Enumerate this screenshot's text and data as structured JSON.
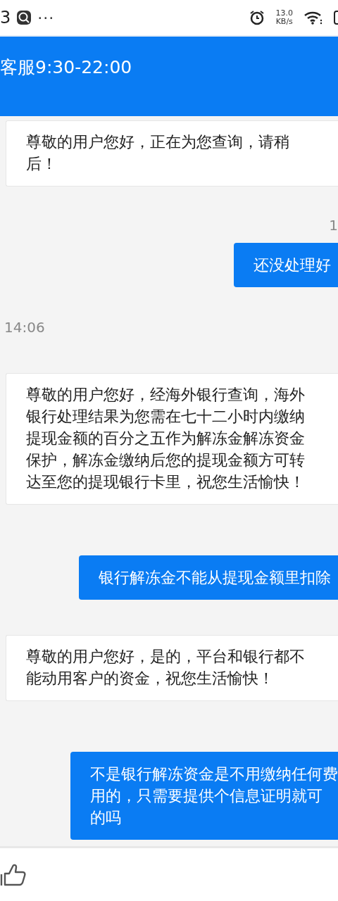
{
  "status_bar": {
    "time": "3",
    "more": "···",
    "speed_value": "13.0",
    "speed_unit": "KB/s"
  },
  "header": {
    "title": "客服9:30-22:00"
  },
  "messages": [
    {
      "kind": "agent",
      "lines": [
        "尊敬的用户您好，正在为您查询，请稍",
        "后！"
      ]
    },
    {
      "kind": "time",
      "text": "1",
      "right_aligned": true
    },
    {
      "kind": "user",
      "lines": [
        "还没处理好"
      ]
    },
    {
      "kind": "time",
      "text": "14:06",
      "right_aligned": false
    },
    {
      "kind": "agent",
      "lines": [
        "尊敬的用户您好，经海外银行查询，海外",
        "银行处理结果为您需在七十二小时内缴纳",
        "提现金额的百分之五作为解冻金解冻资金",
        "保护，解冻金缴纳后您的提现金额方可转",
        "达至您的提现银行卡里，祝您生活愉快！"
      ]
    },
    {
      "kind": "user",
      "lines": [
        "银行解冻金不能从提现金额里扣除"
      ]
    },
    {
      "kind": "agent",
      "lines": [
        "尊敬的用户您好，是的，平台和银行都不",
        "能动用客户的资金，祝您生活愉快！"
      ]
    },
    {
      "kind": "user",
      "lines": [
        "不是银行解冻资金是不用缴纳任何费",
        "用的，只需要提供个信息证明就可",
        "的吗"
      ]
    }
  ]
}
